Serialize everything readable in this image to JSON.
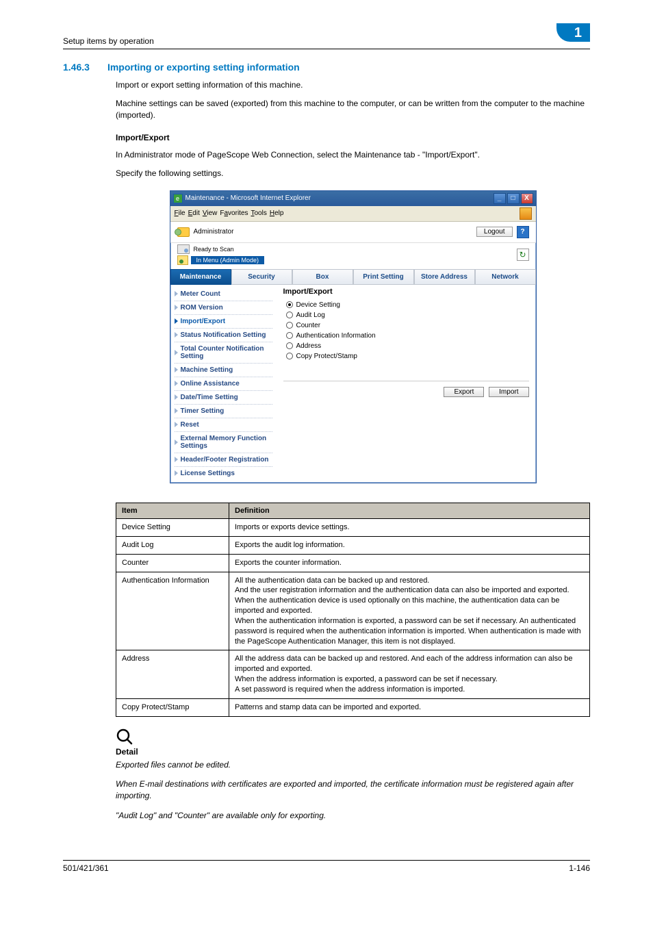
{
  "header": {
    "breadcrumb": "Setup items by operation",
    "chapter": "1"
  },
  "section": {
    "num": "1.46.3",
    "title": "Importing or exporting setting information"
  },
  "paras": {
    "p1": "Import or export setting information of this machine.",
    "p2": "Machine settings can be saved (exported) from this machine to the computer, or can be written from the computer to the machine (imported).",
    "sub": "Import/Export",
    "p3": "In Administrator mode of PageScope Web Connection, select the Maintenance tab - \"Import/Export\".",
    "p4": "Specify the following settings."
  },
  "ie": {
    "title": "Maintenance - Microsoft Internet Explorer",
    "menu": {
      "file": "File",
      "edit": "Edit",
      "view": "View",
      "favorites": "Favorites",
      "tools": "Tools",
      "help": "Help"
    },
    "admin": "Administrator",
    "logout": "Logout",
    "help_q": "?",
    "ready": "Ready to Scan",
    "menumode": "In Menu (Admin Mode)",
    "refresh": "↻",
    "tabs": {
      "maintenance": "Maintenance",
      "security": "Security",
      "box": "Box",
      "print": "Print Setting",
      "store": "Store Address",
      "network": "Network"
    },
    "side": {
      "meter": "Meter Count",
      "rom": "ROM Version",
      "impexp": "Import/Export",
      "status": "Status Notification Setting",
      "total": "Total Counter Notification Setting",
      "machine": "Machine Setting",
      "online": "Online Assistance",
      "datetime": "Date/Time Setting",
      "timer": "Timer Setting",
      "reset": "Reset",
      "extmem": "External Memory Function Settings",
      "header": "Header/Footer Registration",
      "license": "License Settings"
    },
    "content": {
      "title": "Import/Export",
      "opts": {
        "device": "Device Setting",
        "audit": "Audit Log",
        "counter": "Counter",
        "auth": "Authentication Information",
        "addr": "Address",
        "cps": "Copy Protect/Stamp"
      },
      "export": "Export",
      "import": "Import"
    }
  },
  "table": {
    "h1": "Item",
    "h2": "Definition",
    "rows": [
      {
        "item": "Device Setting",
        "def": "Imports or exports device settings."
      },
      {
        "item": "Audit Log",
        "def": "Exports the audit log information."
      },
      {
        "item": "Counter",
        "def": "Exports the counter information."
      },
      {
        "item": "Authentication Information",
        "def": "All the authentication data can be backed up and restored.\nAnd the user registration information and the authentication data can also be imported and exported.\nWhen the authentication device is used optionally on this machine, the authentication data can be imported and exported.\nWhen the authentication information is exported, a password can be set if necessary. An authenticated password is required when the authentication information is imported. When authentication is made with the PageScope Authentication Manager, this item is not displayed."
      },
      {
        "item": "Address",
        "def": "All the address data can be backed up and restored. And each of the address information can also be imported and exported.\nWhen the address information is exported, a password can be set if necessary.\nA set password is required when the address information is imported."
      },
      {
        "item": "Copy Protect/Stamp",
        "def": "Patterns and stamp data can be imported and exported."
      }
    ]
  },
  "detail": {
    "label": "Detail",
    "n1": "Exported files cannot be edited.",
    "n2": "When E-mail destinations with certificates are exported and imported, the certificate information must be registered again after importing.",
    "n3": "\"Audit Log\" and \"Counter\" are available only for exporting."
  },
  "footer": {
    "left": "501/421/361",
    "right": "1-146"
  }
}
